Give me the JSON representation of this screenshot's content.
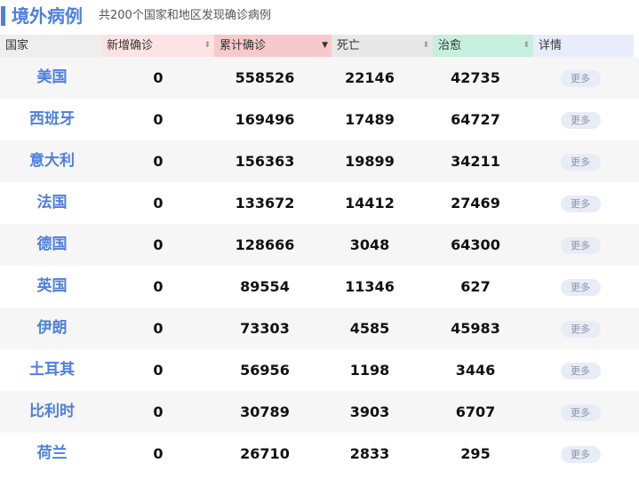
{
  "header": {
    "title": "境外病例",
    "subtitle": "共200个国家和地区发现确诊病例"
  },
  "columns": [
    {
      "key": "country",
      "label": "国家",
      "sortable": false
    },
    {
      "key": "new",
      "label": "新增确诊",
      "sortable": true
    },
    {
      "key": "total",
      "label": "累计确诊",
      "sortable": true,
      "active_sort": "desc"
    },
    {
      "key": "death",
      "label": "死亡",
      "sortable": true
    },
    {
      "key": "cured",
      "label": "治愈",
      "sortable": true
    },
    {
      "key": "detail",
      "label": "详情",
      "sortable": false
    }
  ],
  "more_label": "更多",
  "rows": [
    {
      "country": "美国",
      "new": "0",
      "total": "558526",
      "death": "22146",
      "cured": "42735"
    },
    {
      "country": "西班牙",
      "new": "0",
      "total": "169496",
      "death": "17489",
      "cured": "64727"
    },
    {
      "country": "意大利",
      "new": "0",
      "total": "156363",
      "death": "19899",
      "cured": "34211"
    },
    {
      "country": "法国",
      "new": "0",
      "total": "133672",
      "death": "14412",
      "cured": "27469"
    },
    {
      "country": "德国",
      "new": "0",
      "total": "128666",
      "death": "3048",
      "cured": "64300"
    },
    {
      "country": "英国",
      "new": "0",
      "total": "89554",
      "death": "11346",
      "cured": "627"
    },
    {
      "country": "伊朗",
      "new": "0",
      "total": "73303",
      "death": "4585",
      "cured": "45983"
    },
    {
      "country": "土耳其",
      "new": "0",
      "total": "56956",
      "death": "1198",
      "cured": "3446"
    },
    {
      "country": "比利时",
      "new": "0",
      "total": "30789",
      "death": "3903",
      "cured": "6707"
    },
    {
      "country": "荷兰",
      "new": "0",
      "total": "26710",
      "death": "2833",
      "cured": "295"
    }
  ],
  "colors": {
    "accent": "#4e7fe0",
    "new_header": "#fde3e3",
    "total_header": "#f8c9cb",
    "cured_header": "#c6efe0",
    "detail_header": "#e9edfb"
  }
}
